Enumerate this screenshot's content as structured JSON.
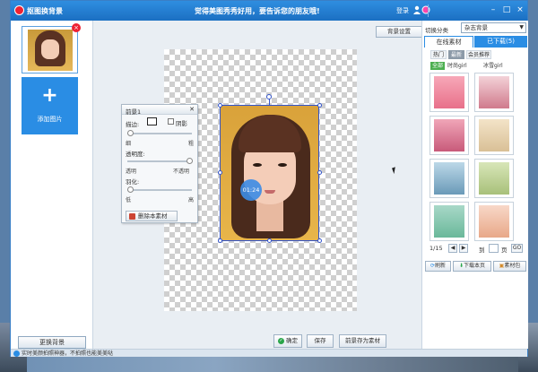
{
  "window": {
    "app_title": "抠图换背景",
    "slogan": "觉得美图秀秀好用，要告诉您的朋友哦!",
    "login_label": "登录",
    "minimize": "–",
    "maximize": "□",
    "close": "×"
  },
  "left_panel": {
    "add_photo_label": "添加图片",
    "change_bg_label": "更换背景"
  },
  "canvas": {
    "bg_settings_label": "背景设置",
    "timer": "01:24"
  },
  "prop_panel": {
    "title": "前景1",
    "stroke_label": "描边:",
    "shadow_label": "阴影",
    "thin_label": "细",
    "thick_label": "粗",
    "opacity_label": "透明度:",
    "transparent_label": "透明",
    "opaque_label": "不透明",
    "feather_label": "羽化:",
    "low_label": "低",
    "high_label": "高",
    "delete_label": "删除本素材"
  },
  "actions": {
    "confirm": "确定",
    "save": "保存",
    "save_as_material": "前景存为素材"
  },
  "right_panel": {
    "category_label": "切换分类",
    "category_value": "杂志背景",
    "tab_online": "在线素材",
    "tab_downloaded": "已下载(5)",
    "filters": [
      "热门",
      "最新",
      "会员推荐"
    ],
    "subfilters": [
      "全部",
      "时尚girl",
      "冰雪girl"
    ],
    "page_current": "1/15",
    "goto_label": "到",
    "page_label": "页",
    "go_label": "GO",
    "refresh_label": "刷新",
    "download_page_label": "下载本页",
    "material_pack_label": "素材包"
  },
  "status": {
    "text": "实时美颜拍照神器，不拍照也能美美哒"
  },
  "colors": {
    "accent": "#2a8de4",
    "titlebar": "#1b6fc2",
    "selection": "#3355cc"
  }
}
